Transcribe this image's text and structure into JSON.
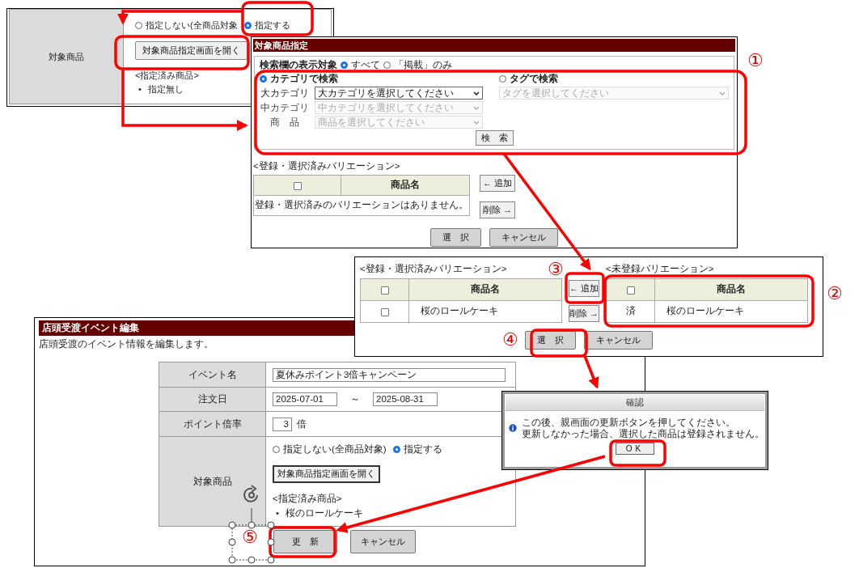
{
  "target_field_panel": {
    "label": "対象商品",
    "radios": [
      {
        "label": "指定しない(全商品対象",
        "selected": false
      },
      {
        "label": "指定する",
        "selected": true
      }
    ],
    "open_button": "対象商品指定画面を開く",
    "specified_heading": "<指定済み商品>",
    "specified_items": [
      {
        "marker": "•",
        "text": "指定無し"
      }
    ]
  },
  "product_dialog": {
    "title": "対象商品指定",
    "display_target_label": "検索欄の表示対象",
    "display_options": [
      {
        "label": "すべて",
        "selected": true
      },
      {
        "label": "「掲載」のみ",
        "selected": false
      }
    ],
    "search_modes": [
      {
        "label": "カテゴリで検索",
        "selected": true
      },
      {
        "label": "タグで検索",
        "selected": false
      }
    ],
    "category_fields": [
      {
        "label": "大カテゴリ",
        "placeholder": "大カテゴリを選択してください",
        "disabled": false
      },
      {
        "label": "中カテゴリ",
        "placeholder": "中カテゴリを選択してください",
        "disabled": true
      },
      {
        "label": "商　品",
        "placeholder": "商品を選択してください",
        "disabled": true
      }
    ],
    "tag_field": {
      "placeholder": "タグを選択してください",
      "disabled": true
    },
    "search_button": "検　索",
    "registered_heading": "<登録・選択済みバリエーション>",
    "registered_table": {
      "header_checked": false,
      "columns": [
        "商品名"
      ],
      "empty_message": "登録・選択済みのバリエーションはありません。"
    },
    "add_button": "← 追加",
    "remove_button": "削除 →",
    "select_button": "選　択",
    "cancel_button": "キャンセル"
  },
  "event_edit": {
    "title": "店頭受渡イベント編集",
    "description": "店頭受渡のイベント情報を編集します。",
    "event_name": {
      "label": "イベント名",
      "value": "夏休みポイント3倍キャンペーン"
    },
    "order_date": {
      "label": "注文日",
      "from": "2025-07-01",
      "separator": "～",
      "to": "2025-08-31"
    },
    "point_rate": {
      "label": "ポイント倍率",
      "value": "3",
      "unit": "倍"
    },
    "target": {
      "label": "対象商品",
      "radios": [
        {
          "label": "指定しない(全商品対象)",
          "selected": false
        },
        {
          "label": "指定する",
          "selected": true
        }
      ],
      "open_button": "対象商品指定画面を開く",
      "specified_heading": "<指定済み商品>",
      "specified_items": [
        {
          "marker": "•",
          "text": "桜のロールケーキ"
        }
      ]
    },
    "update_button": "更　新",
    "cancel_button": "キャンセル"
  },
  "variation_dialog": {
    "registered_heading": "<登録・選択済みバリエーション>",
    "registered_table": {
      "header_checked": false,
      "columns": [
        "商品名"
      ],
      "rows": [
        {
          "name": "桜のロールケーキ",
          "checked": false
        }
      ]
    },
    "unregistered_heading": "<未登録バリエーション>",
    "unregistered_table": {
      "header_checked": false,
      "columns": [
        "商品名"
      ],
      "rows": [
        {
          "status": "済",
          "name": "桜のロールケーキ"
        }
      ]
    },
    "add_button": "← 追加",
    "remove_button": "削除 →",
    "select_button": "選　択",
    "cancel_button": "キャンセル"
  },
  "confirm_dialog": {
    "title": "確認",
    "message_lines": [
      "この後、親画面の更新ボタンを押してください。",
      "更新しなかった場合、選択した商品は登録されません。"
    ],
    "ok_button": "OK"
  },
  "annotations": {
    "step_numbers": [
      "①",
      "②",
      "③",
      "④",
      "⑤"
    ]
  }
}
